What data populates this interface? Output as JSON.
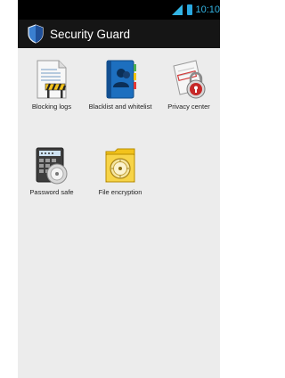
{
  "status_bar": {
    "time": "10:10"
  },
  "action_bar": {
    "title": "Security Guard",
    "icon": "shield-icon"
  },
  "features": [
    {
      "label": "Blocking logs",
      "icon": "blocking-logs-icon"
    },
    {
      "label": "Blacklist and whitelist",
      "icon": "contacts-book-icon"
    },
    {
      "label": "Privacy center",
      "icon": "privacy-lock-icon"
    },
    {
      "label": "Password safe",
      "icon": "password-safe-icon"
    },
    {
      "label": "File encryption",
      "icon": "file-encryption-icon"
    }
  ],
  "colors": {
    "accent": "#33b5e5",
    "action_bar": "#151515",
    "background": "#ececec"
  }
}
